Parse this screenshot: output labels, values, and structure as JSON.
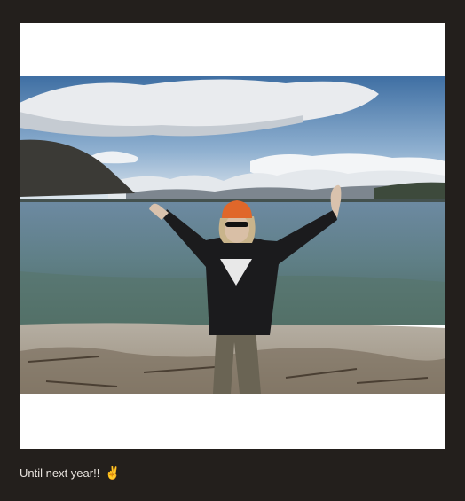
{
  "post": {
    "caption_text": "Until next year!!",
    "caption_emoji": "✌️",
    "caption_emoji_name": "victory-hand-icon"
  },
  "colors": {
    "page_background": "#231f1c",
    "card_background": "#ffffff",
    "caption_text": "#e8e3de"
  }
}
